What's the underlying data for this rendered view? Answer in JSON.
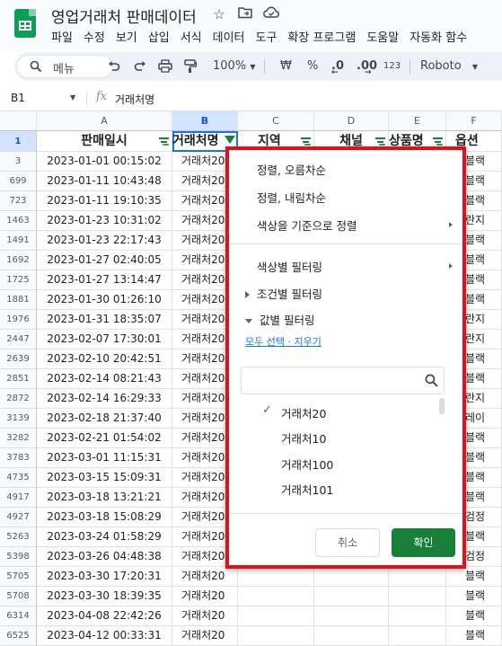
{
  "app": {
    "title": "영업거래처 판매데이터",
    "menus": [
      "파일",
      "수정",
      "보기",
      "삽입",
      "서식",
      "데이터",
      "도구",
      "확장 프로그램",
      "도움말",
      "자동화 함수"
    ]
  },
  "toolbar": {
    "menu_search": "메뉴",
    "zoom": "100%",
    "currency": "₩",
    "percent": "%",
    "dec_decrease": ".0",
    "dec_increase": ".00",
    "number_format": "123",
    "font": "Roboto"
  },
  "formula_bar": {
    "cell_ref": "B1",
    "fx": "fx",
    "value": "거래처명"
  },
  "columns": [
    "A",
    "B",
    "C",
    "D",
    "E",
    "F"
  ],
  "header_row": {
    "num": "1",
    "cells": [
      "판매일시",
      "거래처명",
      "지역",
      "채널",
      "상품명",
      "옵션"
    ]
  },
  "rows": [
    {
      "num": "3",
      "date": "2023-01-01 00:15:02",
      "client": "거래처20",
      "option": "블랙"
    },
    {
      "num": "699",
      "date": "2023-01-11 10:43:48",
      "client": "거래처20",
      "option": "블랙"
    },
    {
      "num": "723",
      "date": "2023-01-11 19:10:35",
      "client": "거래처20",
      "option": "블랙"
    },
    {
      "num": "1463",
      "date": "2023-01-23 10:31:02",
      "client": "거래처20",
      "option": "란지"
    },
    {
      "num": "1491",
      "date": "2023-01-23 22:17:43",
      "client": "거래처20",
      "option": "블랙"
    },
    {
      "num": "1692",
      "date": "2023-01-27 02:40:05",
      "client": "거래처20",
      "option": "블랙"
    },
    {
      "num": "1725",
      "date": "2023-01-27 13:14:47",
      "client": "거래처20",
      "option": "블랙"
    },
    {
      "num": "1881",
      "date": "2023-01-30 01:26:10",
      "client": "거래처20",
      "option": "블랙"
    },
    {
      "num": "1976",
      "date": "2023-01-31 18:35:07",
      "client": "거래처20",
      "option": "란지"
    },
    {
      "num": "2447",
      "date": "2023-02-07 17:30:01",
      "client": "거래처20",
      "option": "란지"
    },
    {
      "num": "2639",
      "date": "2023-02-10 20:42:51",
      "client": "거래처20",
      "option": "블랙"
    },
    {
      "num": "2851",
      "date": "2023-02-14 08:21:43",
      "client": "거래처20",
      "option": "블랙"
    },
    {
      "num": "2872",
      "date": "2023-02-14 16:29:33",
      "client": "거래처20",
      "option": "란지"
    },
    {
      "num": "3139",
      "date": "2023-02-18 21:37:40",
      "client": "거래처20",
      "option": "레이"
    },
    {
      "num": "3282",
      "date": "2023-02-21 01:54:02",
      "client": "거래처20",
      "option": "블랙"
    },
    {
      "num": "3783",
      "date": "2023-03-01 11:15:31",
      "client": "거래처20",
      "option": "블랙"
    },
    {
      "num": "4735",
      "date": "2023-03-15 15:09:31",
      "client": "거래처20",
      "option": "블랙"
    },
    {
      "num": "4917",
      "date": "2023-03-18 13:21:21",
      "client": "거래처20",
      "option": "블랙"
    },
    {
      "num": "4927",
      "date": "2023-03-18 15:08:29",
      "client": "거래처20",
      "option": "검정"
    },
    {
      "num": "5263",
      "date": "2023-03-24 01:58:29",
      "client": "거래처20",
      "option": "블랙"
    },
    {
      "num": "5398",
      "date": "2023-03-26 04:48:38",
      "client": "거래처20",
      "option": "검정"
    },
    {
      "num": "5705",
      "date": "2023-03-30 17:20:31",
      "client": "거래처20",
      "option": "블랙"
    },
    {
      "num": "5708",
      "date": "2023-03-30 18:39:35",
      "client": "거래처20",
      "option": "블랙"
    },
    {
      "num": "6314",
      "date": "2023-04-08 22:42:26",
      "client": "거래처20",
      "option": "블랙"
    },
    {
      "num": "6525",
      "date": "2023-04-12 00:33:31",
      "client": "거래처20",
      "option": "블랙"
    }
  ],
  "filter_panel": {
    "sort_asc": "정렬, 오름차순",
    "sort_desc": "정렬, 내림차순",
    "sort_by_color": "색상을 기준으로 정렬",
    "filter_by_color": "색상별 필터링",
    "filter_by_condition": "조건별 필터링",
    "filter_by_values": "값별 필터링",
    "select_all": "모두 선택",
    "link_sep": " · ",
    "clear": "지우기",
    "values": [
      "거래처20",
      "거래처10",
      "거래처100",
      "거래처101"
    ],
    "cancel": "취소",
    "ok": "확인"
  },
  "colors": {
    "accent_green": "#188038",
    "highlight_border": "#e3101a",
    "selection_blue": "#1a73e8"
  }
}
